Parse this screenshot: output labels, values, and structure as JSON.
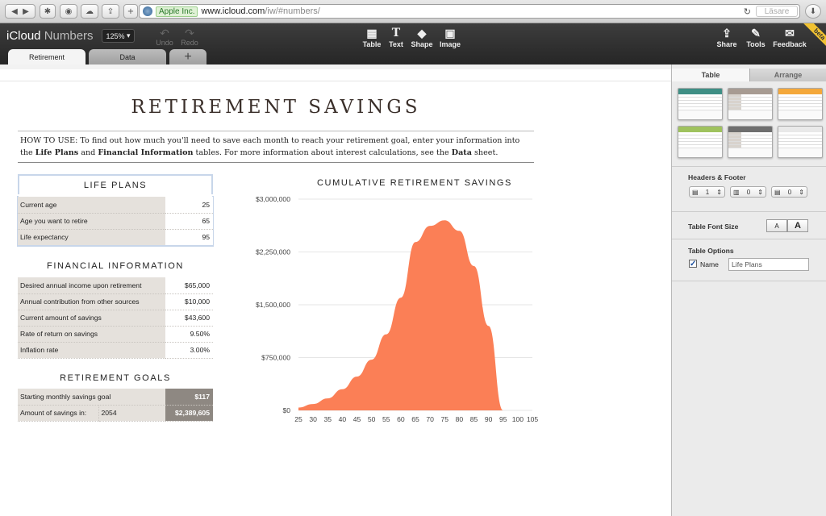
{
  "browser": {
    "ev_label": "Apple Inc.",
    "host": "www.icloud.com",
    "path": "/iw/#numbers/",
    "reader_label": "Läsare",
    "reload_icon": "reload-icon"
  },
  "app": {
    "brand": "iCloud",
    "name": "Numbers",
    "zoom": "125%",
    "undo_label": "Undo",
    "redo_label": "Redo",
    "tools": {
      "table": "Table",
      "text": "Text",
      "shape": "Shape",
      "image": "Image",
      "share": "Share",
      "tools": "Tools",
      "feedback": "Feedback"
    },
    "beta": "beta"
  },
  "sheet_tabs": [
    "Retirement",
    "Data",
    "+"
  ],
  "sheet": {
    "title": "RETIREMENT SAVINGS",
    "howto_1": "HOW TO USE: To find out how much you'll need to save each month to reach your retirement goal, enter your information into the ",
    "howto_b1": "Life Plans",
    "howto_2": " and ",
    "howto_b2": "Financial Information",
    "howto_3": " tables. For more information about interest calculations, see the ",
    "howto_b3": "Data",
    "howto_4": " sheet."
  },
  "life_plans": {
    "title": "LIFE PLANS",
    "rows": [
      {
        "label": "Current age",
        "value": "25"
      },
      {
        "label": "Age you want to retire",
        "value": "65"
      },
      {
        "label": "Life expectancy",
        "value": "95"
      }
    ]
  },
  "financial": {
    "title": "FINANCIAL INFORMATION",
    "rows": [
      {
        "label": "Desired annual income upon retirement",
        "value": "$65,000"
      },
      {
        "label": "Annual contribution from other sources",
        "value": "$10,000"
      },
      {
        "label": "Current amount of savings",
        "value": "$43,600"
      },
      {
        "label": "Rate of return on savings",
        "value": "9.50%"
      },
      {
        "label": "Inflation rate",
        "value": "3.00%"
      }
    ]
  },
  "goals": {
    "title": "RETIREMENT GOALS",
    "row1": {
      "label": "Starting monthly savings goal",
      "value": "$117"
    },
    "row2": {
      "label": "Amount of savings in:",
      "year": "2054",
      "value": "$2,389,605"
    }
  },
  "chart_data": {
    "type": "area",
    "title": "CUMULATIVE RETIREMENT SAVINGS",
    "x": [
      25,
      30,
      35,
      40,
      45,
      50,
      55,
      60,
      65,
      70,
      75,
      80,
      85,
      90,
      95
    ],
    "values": [
      40000,
      90000,
      170000,
      300000,
      480000,
      720000,
      1080000,
      1600000,
      2390000,
      2620000,
      2700000,
      2550000,
      2050000,
      1200000,
      0
    ],
    "xticks": [
      "25",
      "30",
      "35",
      "40",
      "45",
      "50",
      "55",
      "60",
      "65",
      "70",
      "75",
      "80",
      "85",
      "90",
      "95",
      "100",
      "105"
    ],
    "yticks": [
      "$0",
      "$750,000",
      "$1,500,000",
      "$2,250,000",
      "$3,000,000"
    ],
    "ylim": [
      0,
      3000000
    ],
    "xlim": [
      25,
      105
    ],
    "color": "#fb7f56"
  },
  "sidebar": {
    "tabs": [
      "Table",
      "Arrange"
    ],
    "headers_footer_label": "Headers & Footer",
    "header_rows": "1",
    "header_cols": "0",
    "footer_rows": "0",
    "font_size_label": "Table Font Size",
    "font_small": "A",
    "font_large": "A",
    "options_label": "Table Options",
    "name_label": "Name",
    "name_value": "Life Plans",
    "style_colors": [
      "#3f8f85",
      "#a79b92",
      "#f4a83b",
      "#9fc25e",
      "#6e6e6e",
      "#e9e9e9"
    ]
  }
}
